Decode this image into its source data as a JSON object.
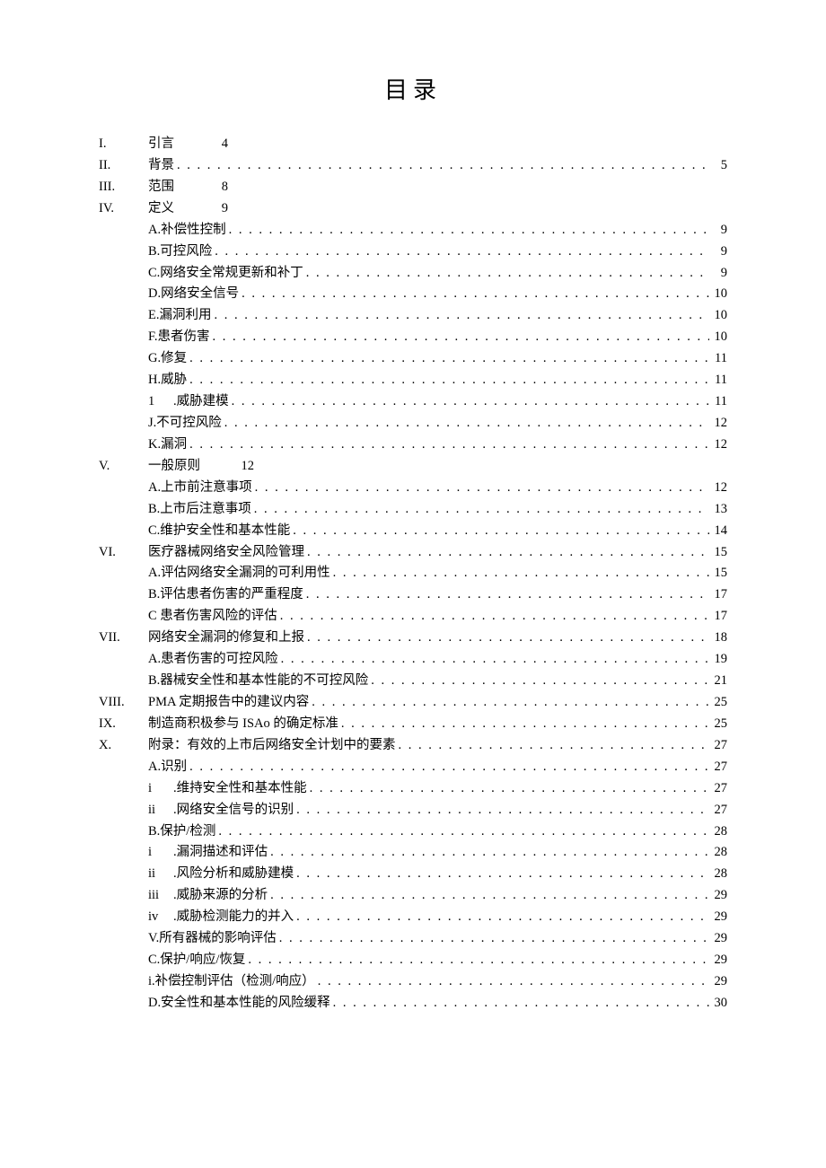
{
  "title": "目录",
  "entries": [
    {
      "num": "I.",
      "label": "引言",
      "page": "4",
      "dotted": false,
      "indent": 0
    },
    {
      "num": "II.",
      "label": "背景",
      "page": "5",
      "dotted": true,
      "indent": 0
    },
    {
      "num": "III.",
      "label": "范围",
      "page": "8",
      "dotted": false,
      "indent": 0
    },
    {
      "num": "IV.",
      "label": "定义",
      "page": "9",
      "dotted": false,
      "indent": 0
    },
    {
      "num": "",
      "label": "A.补偿性控制",
      "page": "9",
      "dotted": true,
      "indent": 1
    },
    {
      "num": "",
      "label": "B.可控风险",
      "page": "9",
      "dotted": true,
      "indent": 1
    },
    {
      "num": "",
      "label": "C.网络安全常规更新和补丁",
      "page": "9",
      "dotted": true,
      "indent": 1
    },
    {
      "num": "",
      "label": "D.网络安全信号",
      "page": "10",
      "dotted": true,
      "indent": 1
    },
    {
      "num": "",
      "label": "E.漏洞利用",
      "page": "10",
      "dotted": true,
      "indent": 1
    },
    {
      "num": "",
      "label": "F.患者伤害",
      "page": "10",
      "dotted": true,
      "indent": 1
    },
    {
      "num": "",
      "label": "G.修复",
      "page": "11",
      "dotted": true,
      "indent": 1
    },
    {
      "num": "",
      "label": "H.威胁",
      "page": "11",
      "dotted": true,
      "indent": 1
    },
    {
      "num": "",
      "marker": "1",
      "label": " .威胁建模",
      "page": "11",
      "dotted": true,
      "indent": 1
    },
    {
      "num": "",
      "label": "J.不可控风险",
      "page": "12",
      "dotted": true,
      "indent": 1
    },
    {
      "num": "",
      "label": "K.漏洞",
      "page": "12",
      "dotted": true,
      "indent": 1
    },
    {
      "num": "V.",
      "label": "一般原则",
      "page": "12",
      "dotted": false,
      "indent": 0
    },
    {
      "num": "",
      "label": "A.上市前注意事项",
      "page": "12",
      "dotted": true,
      "indent": 1
    },
    {
      "num": "",
      "label": "B.上市后注意事项",
      "page": "13",
      "dotted": true,
      "indent": 1
    },
    {
      "num": "",
      "label": "C.维护安全性和基本性能",
      "page": "14",
      "dotted": true,
      "indent": 1
    },
    {
      "num": "VI.",
      "label": "医疗器械网络安全风险管理",
      "page": "15",
      "dotted": true,
      "indent": 0
    },
    {
      "num": "",
      "label": "A.评估网络安全漏洞的可利用性",
      "page": "15",
      "dotted": true,
      "indent": 1
    },
    {
      "num": "",
      "label": "B.评估患者伤害的严重程度",
      "page": "17",
      "dotted": true,
      "indent": 1
    },
    {
      "num": "",
      "label": "C 患者伤害风险的评估",
      "page": "17",
      "dotted": true,
      "indent": 1
    },
    {
      "num": "VII.",
      "label": "网络安全漏洞的修复和上报",
      "page": "18",
      "dotted": true,
      "indent": 0
    },
    {
      "num": "",
      "label": "A.患者伤害的可控风险",
      "page": "19",
      "dotted": true,
      "indent": 1
    },
    {
      "num": "",
      "label": "B.器械安全性和基本性能的不可控风险",
      "page": "21",
      "dotted": true,
      "indent": 1
    },
    {
      "num": "VIII.",
      "label": "PMA 定期报告中的建议内容",
      "page": "25",
      "dotted": true,
      "indent": 0
    },
    {
      "num": "IX.",
      "label": "制造商积极参与 ISAo 的确定标准",
      "page": "25",
      "dotted": true,
      "indent": 0
    },
    {
      "num": "X.",
      "label": "附录：有效的上市后网络安全计划中的要素",
      "page": "27",
      "dotted": true,
      "indent": 0
    },
    {
      "num": "",
      "label": "A.识别",
      "page": "27",
      "dotted": true,
      "indent": 1
    },
    {
      "num": "",
      "marker": "i",
      "label": " .维持安全性和基本性能",
      "page": "27",
      "dotted": true,
      "indent": 1
    },
    {
      "num": "",
      "marker": "ii",
      "label": " .网络安全信号的识别",
      "page": "27",
      "dotted": true,
      "indent": 1
    },
    {
      "num": "",
      "label": "B.保护/检测",
      "page": "28",
      "dotted": true,
      "indent": 1
    },
    {
      "num": "",
      "marker": "i",
      "label": " .漏洞描述和评估",
      "page": "28",
      "dotted": true,
      "indent": 1
    },
    {
      "num": "",
      "marker": "ii",
      "label": " .风险分析和威胁建模",
      "page": "28",
      "dotted": true,
      "indent": 1
    },
    {
      "num": "",
      "marker": "iii",
      "label": " .威胁来源的分析",
      "page": "29",
      "dotted": true,
      "indent": 1
    },
    {
      "num": "",
      "marker": "iv",
      "label": " .威胁检测能力的并入",
      "page": "29",
      "dotted": true,
      "indent": 1
    },
    {
      "num": "",
      "label": "V.所有器械的影响评估",
      "page": "29",
      "dotted": true,
      "indent": 1
    },
    {
      "num": "",
      "label": "C.保护/响应/恢复",
      "page": "29",
      "dotted": true,
      "indent": 1
    },
    {
      "num": "",
      "label": "i.补偿控制评估（检测/响应）",
      "page": "29",
      "dotted": true,
      "indent": 1
    },
    {
      "num": "",
      "label": "D.安全性和基本性能的风险缓释",
      "page": "30",
      "dotted": true,
      "indent": 1
    }
  ]
}
